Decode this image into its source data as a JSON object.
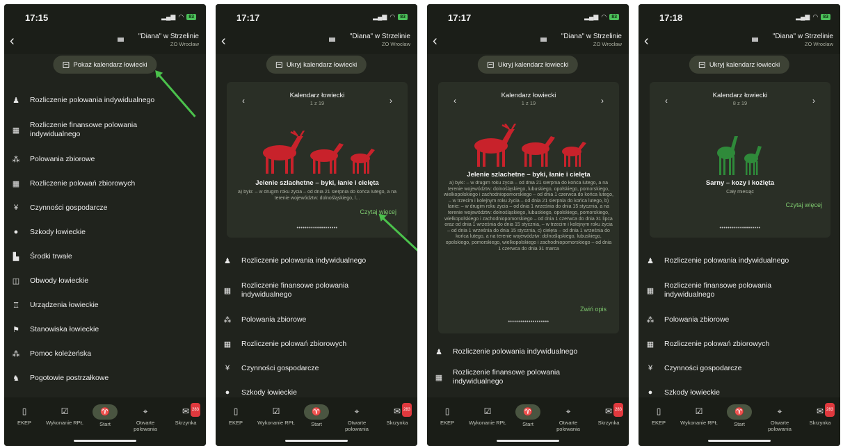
{
  "common": {
    "club_name": "\"Diana\" w Strzelinie",
    "club_sub": "ZO Wrocław",
    "battery": "83",
    "nav": [
      {
        "label": "EKEP"
      },
      {
        "label": "Wykonanie RPŁ"
      },
      {
        "label": "Start"
      },
      {
        "label": "Otwarte polowania"
      },
      {
        "label": "Skrzynka"
      }
    ],
    "inbox_badge": "283"
  },
  "menu_labels": [
    "Rozliczenie polowania indywidualnego",
    "Rozliczenie finansowe polowania indywidualnego",
    "Polowania zbiorowe",
    "Rozliczenie polowań zbiorowych",
    "Czynności gospodarcze",
    "Szkody łowieckie",
    "Środki trwałe",
    "Obwody łowieckie",
    "Urządzenia łowieckie",
    "Stanowiska łowieckie",
    "Pomoc koleżeńska",
    "Pogotowie postrzałkowe"
  ],
  "screens": [
    {
      "time": "17:15",
      "button": "Pokaż kalendarz łowiecki"
    },
    {
      "time": "17:17",
      "button": "Ukryj kalendarz łowiecki",
      "card": {
        "title": "Kalendarz łowiecki",
        "page": "1 z 19",
        "animal": "Jelenie szlachetne – byki, łanie i cielęta",
        "desc": "a) byki: – w drugim roku życia – od dnia 21 sierpnia do końca lutego, a na terenie województw: dolnośląskiego, l...",
        "link": "Czytaj więcej"
      }
    },
    {
      "time": "17:17",
      "button": "Ukryj kalendarz łowiecki",
      "card": {
        "title": "Kalendarz łowiecki",
        "page": "1 z 19",
        "animal": "Jelenie szlachetne – byki, łanie i cielęta",
        "desc": "a) byki: – w drugim roku życia – od dnia 21 sierpnia do końca lutego, a na terenie województw: dolnośląskiego, lubuskiego, opolskiego, pomorskiego, wielkopolskiego i zachodniopomorskiego – od dnia 1 czerwca do końca lutego, – w trzecim i kolejnym roku życia – od dnia 21 sierpnia do końca lutego, b) łanie: – w drugim roku życia – od dnia 1 września do dnia 15 stycznia, a na terenie województw: dolnośląskiego, lubuskiego, opolskiego, pomorskiego, wielkopolskiego i zachodniopomorskiego – od dnia 1 czerwca do dnia 31 lipca oraz od dnia 1 września do dnia 15 stycznia, – w trzecim i kolejnym roku życia – od dnia 1 września do dnia 15 stycznia, c) cielęta – od dnia 1 września do końca lutego, a na terenie województw: dolnośląskiego, lubuskiego, opolskiego, pomorskiego, wielkopolskiego i zachodniopomorskiego – od dnia 1 czerwca do dnia 31 marca",
        "link": "Zwiń opis"
      }
    },
    {
      "time": "17:18",
      "button": "Ukryj kalendarz łowiecki",
      "card": {
        "title": "Kalendarz łowiecki",
        "page": "8 z 19",
        "animal": "Sarny – kozy i koźlęta",
        "desc": "Cały miesiąc",
        "link": "Czytaj więcej"
      }
    }
  ],
  "colors": {
    "deer_red": "#c8222b",
    "roe_green": "#2f8a3a",
    "annotation_arrow": "#4bc24c",
    "link": "#7ec96f"
  }
}
